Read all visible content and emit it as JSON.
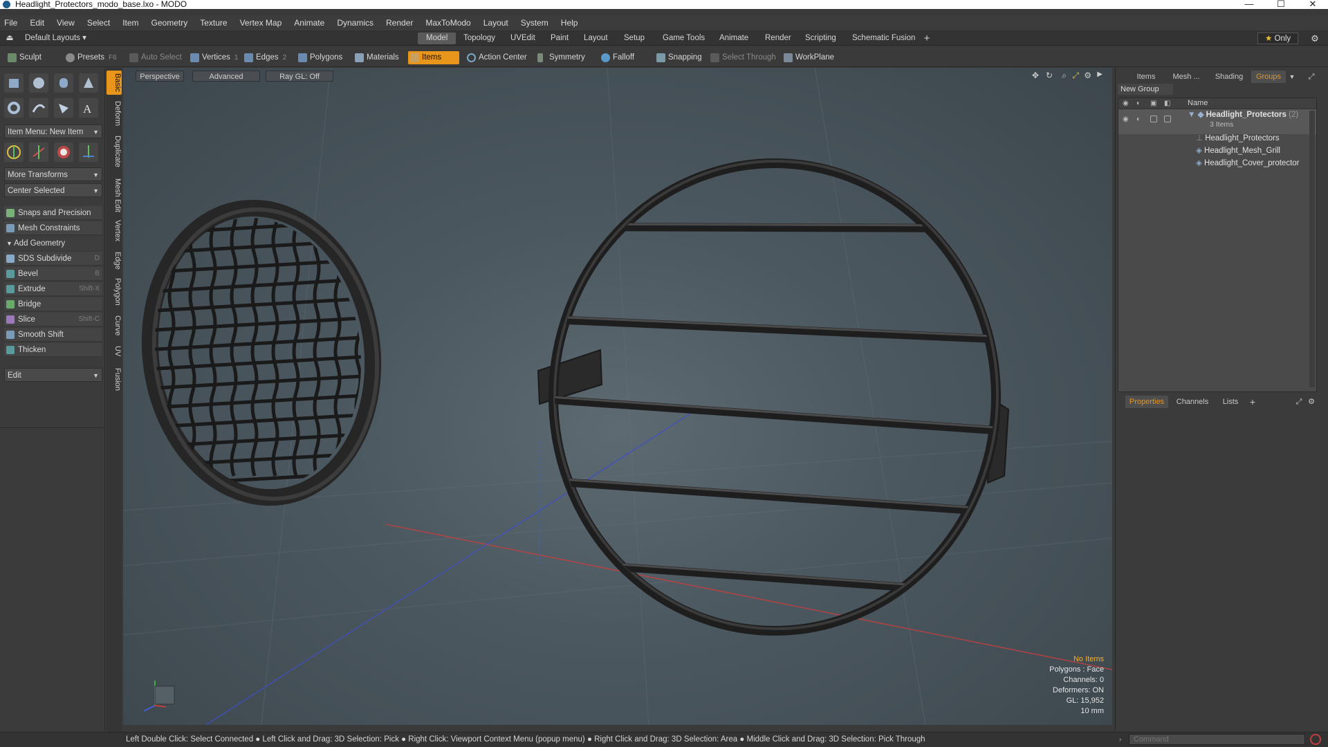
{
  "window": {
    "title": "Headlight_Protectors_modo_base.lxo - MODO",
    "controls": {
      "minimize": "—",
      "maximize": "☐",
      "close": "✕"
    }
  },
  "menu": [
    "File",
    "Edit",
    "View",
    "Select",
    "Item",
    "Geometry",
    "Texture",
    "Vertex Map",
    "Animate",
    "Dynamics",
    "Render",
    "MaxToModo",
    "Layout",
    "System",
    "Help"
  ],
  "layoutbar": {
    "layouts_label": "Default Layouts",
    "tabs": [
      "Model",
      "Topology",
      "UVEdit",
      "Paint",
      "Layout",
      "Setup",
      "Game Tools",
      "Animate",
      "Render",
      "Scripting",
      "Schematic Fusion"
    ],
    "active_tab": "Model",
    "add": "+",
    "only": "Only"
  },
  "toolbar": {
    "sculpt": "Sculpt",
    "presets": "Presets",
    "presets_key": "F6",
    "auto_select": "Auto Select",
    "vertices": "Vertices",
    "vertices_count": "1",
    "edges": "Edges",
    "edges_count": "2",
    "polygons": "Polygons",
    "materials": "Materials",
    "items": "Items",
    "action_center": "Action Center",
    "symmetry": "Symmetry",
    "falloff": "Falloff",
    "snapping": "Snapping",
    "select_through": "Select Through",
    "workplane": "WorkPlane"
  },
  "leftpanel": {
    "item_menu": "Item Menu: New Item",
    "more_transforms": "More Transforms",
    "center_selected": "Center Selected",
    "snaps": "Snaps and Precision",
    "mesh_constraints": "Mesh Constraints",
    "add_geometry": "Add Geometry",
    "tools": [
      {
        "label": "SDS Subdivide",
        "key": "D"
      },
      {
        "label": "Bevel",
        "key": "B"
      },
      {
        "label": "Extrude",
        "key": "Shift-X"
      },
      {
        "label": "Bridge",
        "key": ""
      },
      {
        "label": "Slice",
        "key": "Shift-C"
      },
      {
        "label": "Smooth Shift",
        "key": ""
      },
      {
        "label": "Thicken",
        "key": ""
      }
    ],
    "edit": "Edit"
  },
  "vtabs": [
    "Basic",
    "Deform",
    "Duplicate",
    "Mesh Edit",
    "Vertex",
    "Edge",
    "Polygon",
    "Curve",
    "UV",
    "Fusion"
  ],
  "viewport": {
    "perspective": "Perspective",
    "advanced": "Advanced",
    "raygl": "Ray GL: Off",
    "info": {
      "no_items": "No Items",
      "polygons": "Polygons : Face",
      "channels": "Channels: 0",
      "deformers": "Deformers: ON",
      "gl": "GL: 15,952",
      "unit": "10 mm"
    }
  },
  "rightpanel": {
    "top_tabs": [
      "Items",
      "Mesh ...",
      "Shading",
      "Groups"
    ],
    "active_top_tab": "Groups",
    "new_group": "New Group",
    "tree_header": "Name",
    "group_name": "Headlight_Protectors",
    "group_count": "(2)",
    "group_sub": "3 Items",
    "children": [
      "Headlight_Protectors",
      "Headlight_Mesh_Grill",
      "Headlight_Cover_protector"
    ],
    "bottom_tabs": [
      "Properties",
      "Channels",
      "Lists"
    ],
    "active_bottom_tab": "Properties",
    "add": "+"
  },
  "statusbar": {
    "text": "Left Double Click: Select Connected ● Left Click and Drag: 3D Selection: Pick ● Right Click: Viewport Context Menu (popup menu) ● Right Click and Drag: 3D Selection: Area ● Middle Click and Drag: 3D Selection: Pick Through",
    "command_placeholder": "Command"
  },
  "colors": {
    "accent": "#e8951c",
    "viewport_bg": "#4c5860",
    "panel": "#3b3b3b"
  }
}
